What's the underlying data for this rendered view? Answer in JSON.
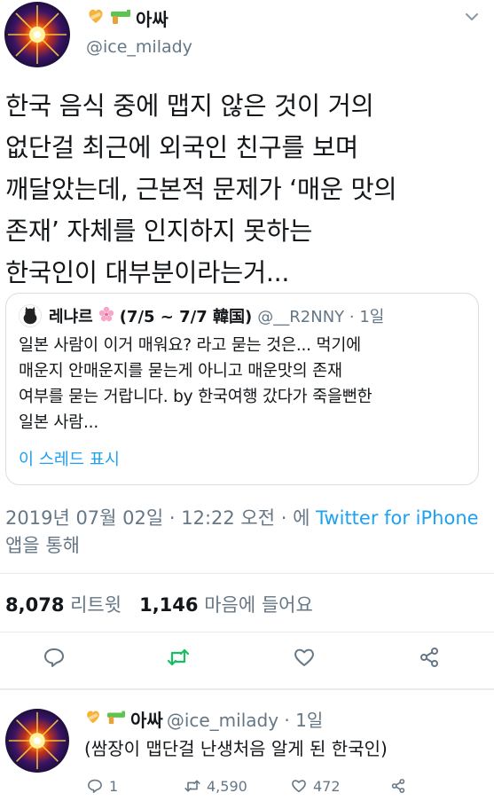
{
  "tweet": {
    "author_name": "아싸",
    "author_handle": "@ice_milady",
    "text_lines": [
      "한국 음식 중에 맵지 않은 것이 거의",
      "없단걸 최근에 외국인 친구를 보며",
      "깨달았는데, 근본적 문제가 ‘매운 맛의",
      "존재’ 자체를 인지하지 못하는",
      "한국인이 대부분이라는거..."
    ],
    "quote": {
      "name": "레냐르",
      "name_suffix": "(7/5 ~ 7/7 韓国)",
      "handle_time": "@__R2NNY · 1일",
      "body_lines": [
        "일본 사람이 이거 매워요? 라고 묻는 것은... 먹기에",
        "매운지 안매운지를 묻는게 아니고 매운맛의 존재",
        "여부를 묻는 거랍니다. by 한국여행 갔다가 죽을뻔한",
        "일본 사람..."
      ],
      "show_thread": "이 스레드 표시"
    },
    "meta_prefix": "2019년 07월 02일 · 12:22 오전 · 에 ",
    "meta_link": "Twitter for iPhone",
    "meta_suffix": " 앱을 통해",
    "retweets_count": "8,078",
    "retweets_label": " 리트윗",
    "likes_count": "1,146",
    "likes_label": " 마음에 들어요"
  },
  "reply": {
    "author_name": "아싸",
    "meta": "@ice_milady · 1일",
    "text": "(쌈장이 맵단걸 난생처음 알게 된 한국인)",
    "reply_count": "1",
    "retweet_count": "4,590",
    "like_count": "472"
  },
  "icons": {
    "accent": "#1da1f2",
    "retweet_green": "#17bf63",
    "muted": "#657786"
  }
}
